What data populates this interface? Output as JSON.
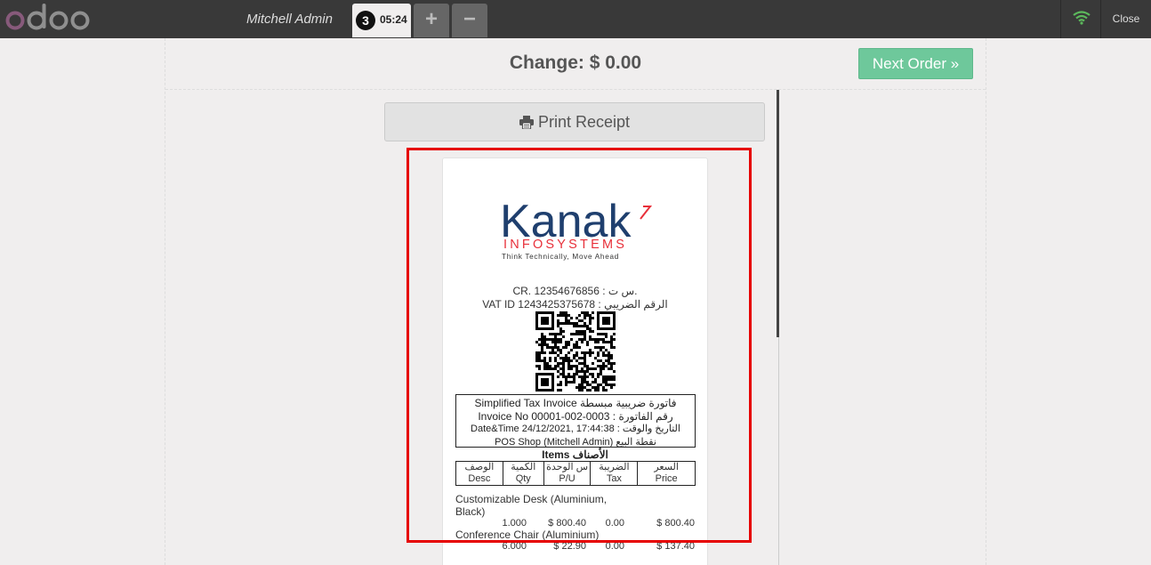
{
  "topbar": {
    "logo_text": "odoo",
    "cashier": "Mitchell Admin",
    "order_number": "3",
    "order_time": "05:24",
    "add_label": "+",
    "remove_label": "−",
    "close_label": "Close",
    "icons": {
      "wifi": "wifi-icon"
    }
  },
  "payment": {
    "change_label": "Change: $ 0.00",
    "next_order_label": "Next Order »",
    "print_label": "Print Receipt"
  },
  "receipt": {
    "logo_main": "Kanak",
    "logo_sub": "INFOSYSTEMS",
    "logo_tagline": "Think Technically, Move Ahead",
    "cr_line": "CR. 12354676856 : س ت.",
    "vat_line": "VAT ID 1243425375678 : الرقم الضريبي",
    "invoice_type": "Simplified Tax Invoice فاتورة ضريبية مبسطة",
    "invoice_no": "Invoice No 00001-002-0003 : رقم الفاتورة",
    "datetime": "Date&Time 24/12/2021, 17:44:38 : التاريخ والوقت",
    "pos_shop": "POS Shop (Mitchell Admin) نقطة البيع",
    "items_title": "Items الأصناف",
    "columns": [
      {
        "ar": "الوصف",
        "en": "Desc"
      },
      {
        "ar": "الكمية",
        "en": "Qty"
      },
      {
        "ar": "س الوحدة",
        "en": "P/U"
      },
      {
        "ar": "الضريبة",
        "en": "Tax"
      },
      {
        "ar": "السعر",
        "en": "Price"
      }
    ],
    "items": [
      {
        "name": "Customizable Desk (Aluminium, Black)",
        "qty": "1.000",
        "pu": "$ 800.40",
        "tax": "0.00",
        "price": "$ 800.40"
      },
      {
        "name": "Conference Chair (Aluminium)",
        "qty": "6.000",
        "pu": "$ 22.90",
        "tax": "0.00",
        "price": "$ 137.40"
      }
    ]
  },
  "colors": {
    "topbar": "#393939",
    "next_order": "#6ec89b",
    "highlight": "#e60000",
    "odoo_purple": "#875a7b",
    "kanak_blue": "#1f3f6e",
    "kanak_red": "#e8303a"
  }
}
